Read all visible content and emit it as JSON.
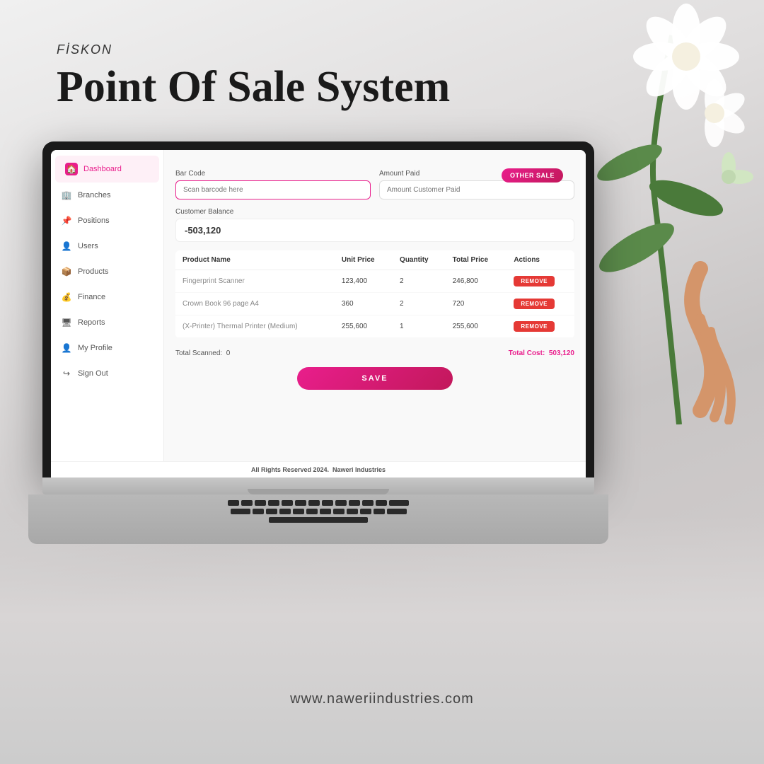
{
  "branding": {
    "company": "FİSKON",
    "tagline": "Point Of Sale System",
    "website": "www.naweriindustries.com"
  },
  "sidebar": {
    "items": [
      {
        "id": "dashboard",
        "label": "Dashboard",
        "icon": "🏠",
        "active": true
      },
      {
        "id": "branches",
        "label": "Branches",
        "icon": "🏢",
        "active": false
      },
      {
        "id": "positions",
        "label": "Positions",
        "icon": "📌",
        "active": false
      },
      {
        "id": "users",
        "label": "Users",
        "icon": "👤",
        "active": false
      },
      {
        "id": "products",
        "label": "Products",
        "icon": "📦",
        "active": false
      },
      {
        "id": "finance",
        "label": "Finance",
        "icon": "💰",
        "active": false
      },
      {
        "id": "reports",
        "label": "Reports",
        "icon": "🖥",
        "active": false
      },
      {
        "id": "myprofile",
        "label": "My Profile",
        "icon": "👤",
        "active": false
      },
      {
        "id": "signout",
        "label": "Sign Out",
        "icon": "↪",
        "active": false
      }
    ]
  },
  "main": {
    "other_sale_button": "OTHER SALE",
    "barcode_label": "Bar Code",
    "barcode_placeholder": "Scan barcode here",
    "amount_label": "Amount Paid",
    "amount_placeholder": "Amount Customer Paid",
    "customer_balance_label": "Customer Balance",
    "customer_balance_value": "-503,120",
    "table_headers": [
      "Product Name",
      "Unit Price",
      "Quantity",
      "Total Price",
      "Actions"
    ],
    "products": [
      {
        "name": "Fingerprint Scanner",
        "unit_price": "123,400",
        "quantity": "2",
        "total_price": "246,800"
      },
      {
        "name": "Crown Book 96 page A4",
        "unit_price": "360",
        "quantity": "2",
        "total_price": "720"
      },
      {
        "name": "(X-Printer) Thermal Printer (Medium)",
        "unit_price": "255,600",
        "quantity": "1",
        "total_price": "255,600"
      }
    ],
    "remove_label": "REMOVE",
    "total_scanned_label": "Total Scanned:",
    "total_scanned_value": "0",
    "total_cost_label": "Total Cost:",
    "total_cost_value": "503,120",
    "save_button": "SAVE",
    "footer_copyright": "All Rights Reserved 2024.",
    "footer_company": "Naweri Industries"
  },
  "colors": {
    "brand_pink": "#e91e8c",
    "remove_red": "#e53935",
    "balance_negative": "#333",
    "total_cost_pink": "#e91e8c"
  }
}
